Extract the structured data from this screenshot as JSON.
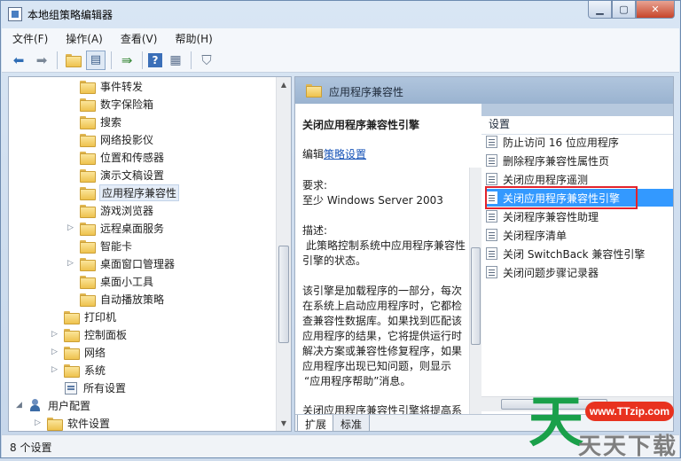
{
  "window": {
    "title": "本地组策略编辑器"
  },
  "controls": {
    "minimize": "▁",
    "maximize": "▢",
    "close": "✕"
  },
  "menu": [
    "文件(F)",
    "操作(A)",
    "查看(V)",
    "帮助(H)"
  ],
  "toolbar": {
    "icons": [
      "back-arrow-icon",
      "forward-arrow-icon",
      "up-folder-icon",
      "show-tree-icon",
      "export-list-icon",
      "help-icon",
      "properties-icon",
      "filter-icon"
    ]
  },
  "tree": {
    "items": [
      {
        "label": "事件转发",
        "type": "folder",
        "level": 3,
        "expander": ""
      },
      {
        "label": "数字保险箱",
        "type": "folder",
        "level": 3,
        "expander": ""
      },
      {
        "label": "搜索",
        "type": "folder",
        "level": 3,
        "expander": ""
      },
      {
        "label": "网络投影仪",
        "type": "folder",
        "level": 3,
        "expander": ""
      },
      {
        "label": "位置和传感器",
        "type": "folder",
        "level": 3,
        "expander": ""
      },
      {
        "label": "演示文稿设置",
        "type": "folder",
        "level": 3,
        "expander": ""
      },
      {
        "label": "应用程序兼容性",
        "type": "folder",
        "level": 3,
        "expander": "",
        "selected": true
      },
      {
        "label": "游戏浏览器",
        "type": "folder",
        "level": 3,
        "expander": ""
      },
      {
        "label": "远程桌面服务",
        "type": "folder",
        "level": 3,
        "expander": "▷"
      },
      {
        "label": "智能卡",
        "type": "folder",
        "level": 3,
        "expander": ""
      },
      {
        "label": "桌面窗口管理器",
        "type": "folder",
        "level": 3,
        "expander": "▷"
      },
      {
        "label": "桌面小工具",
        "type": "folder",
        "level": 3,
        "expander": ""
      },
      {
        "label": "自动播放策略",
        "type": "folder",
        "level": 3,
        "expander": ""
      },
      {
        "label": "打印机",
        "type": "folder",
        "level": 2,
        "expander": ""
      },
      {
        "label": "控制面板",
        "type": "folder",
        "level": 2,
        "expander": "▷"
      },
      {
        "label": "网络",
        "type": "folder",
        "level": 2,
        "expander": "▷"
      },
      {
        "label": "系统",
        "type": "folder",
        "level": 2,
        "expander": "▷"
      },
      {
        "label": "所有设置",
        "type": "allsettings",
        "level": 2,
        "expander": ""
      },
      {
        "label": "用户配置",
        "type": "user",
        "level": 0,
        "expander": "◢"
      },
      {
        "label": "软件设置",
        "type": "folder",
        "level": 1,
        "expander": "▷"
      }
    ]
  },
  "details": {
    "header": "应用程序兼容性",
    "title": "关闭应用程序兼容性引擎",
    "edit_prefix": "编辑",
    "edit_link": "策略设置",
    "requirement_label": "要求:",
    "requirement_value": "至少 Windows Server 2003",
    "description_label": "描述:",
    "description_lines": [
      "此策略控制系统中应用程序兼容性",
      "引擎的状态。"
    ],
    "body_lines": [
      "该引擎是加载程序的一部分，每次",
      "在系统上启动应用程序时，它都检",
      "查兼容性数据库。如果找到匹配该",
      "应用程序的结果，它将提供运行时",
      "解决方案或兼容性修复程序，如果",
      "应用程序出现已知问题，则显示",
      "“应用程序帮助”消息。"
    ],
    "cut_line": "关闭应用程序兼容性引擎将提高系"
  },
  "settings": {
    "column_header": "设置",
    "items": [
      {
        "label": "防止访问 16 位应用程序"
      },
      {
        "label": "删除程序兼容性属性页"
      },
      {
        "label": "关闭应用程序遥测"
      },
      {
        "label": "关闭应用程序兼容性引擎",
        "selected": true
      },
      {
        "label": "关闭程序兼容性助理"
      },
      {
        "label": "关闭程序清单"
      },
      {
        "label": "关闭 SwitchBack 兼容性引擎"
      },
      {
        "label": "关闭问题步骤记录器"
      }
    ]
  },
  "tabs": [
    "扩展",
    "标准"
  ],
  "status": {
    "text": "8 个设置"
  },
  "watermark": {
    "glyph": "天",
    "url": "www.TTzip.com",
    "brand": "天天下载"
  },
  "colors": {
    "selection": "#3399ff",
    "highlight_box": "#e3232c",
    "header_band": "#a9bfd9"
  }
}
